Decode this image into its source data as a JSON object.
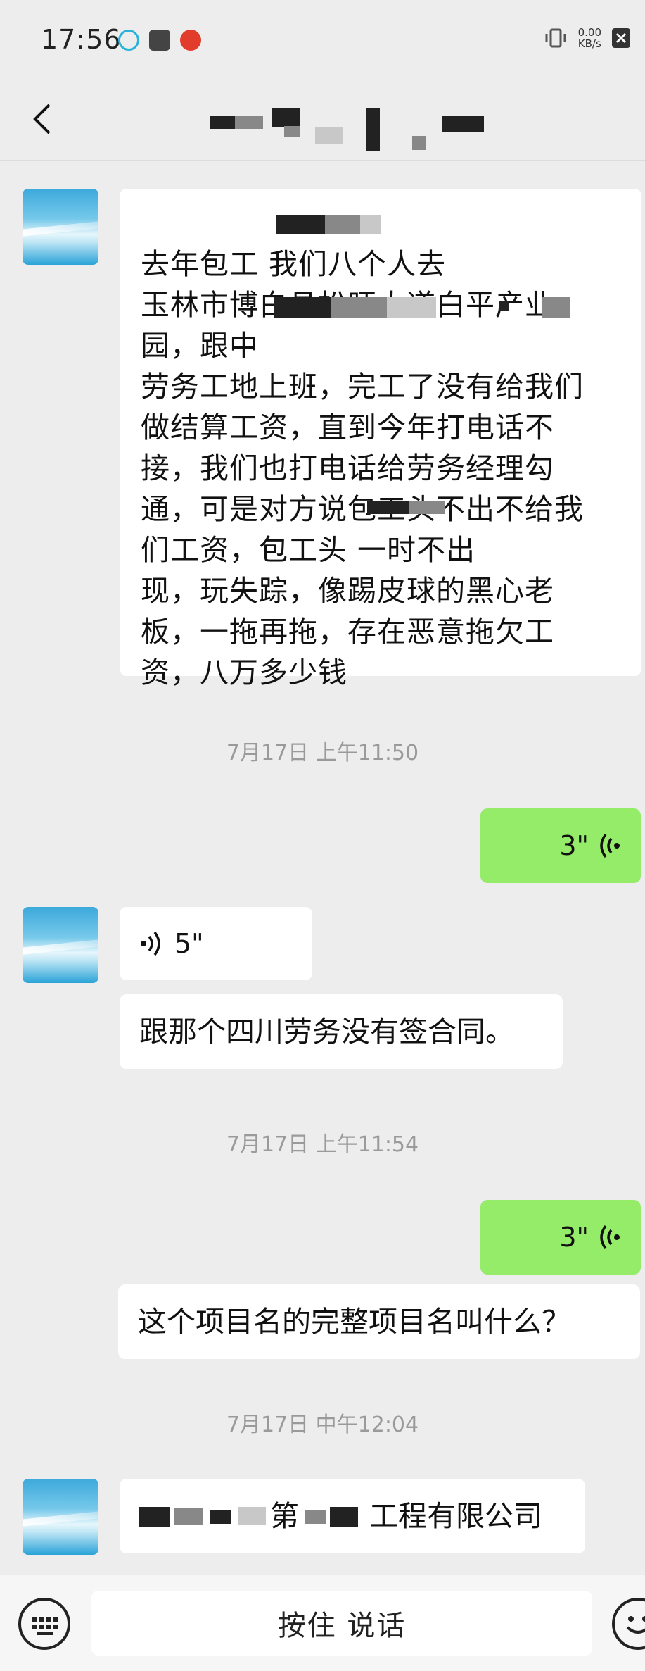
{
  "status_bar": {
    "time": "17:56",
    "net_speed_value": "0.00",
    "net_speed_unit": "KB/s"
  },
  "title_bar": {
    "title": ""
  },
  "messages": {
    "m1": "去年包工      我们八个人去\n玉林市博白县松旺大道白平产业\n园，跟中                  \n劳务工地上班，完工了没有给我们\n做结算工资，直到今年打电话不\n接，我们也打电话给劳务经理勾\n通，可是对方说包工头不出不给我\n们工资，包工头      一时不出\n现，玩失踪，像踢皮球的黑心老\n板，一拖再拖，存在恶意拖欠工\n资，八万多少钱",
    "ts1": "7月17日 上午11:50",
    "voice_out_1": "3\"",
    "voice_in_1": "5\"",
    "m2": "跟那个四川劳务没有签合同。",
    "ts2": "7月17日 上午11:54",
    "voice_out_2": "3\"",
    "m3": "这个项目名的完整项目名叫什么？",
    "ts3": "7月17日 中午12:04",
    "m4_part1": "第",
    "m4_part2": "工程有限公司"
  },
  "bottom_bar": {
    "hold_to_talk": "按住 说话"
  },
  "icons": [
    "back-icon",
    "keyboard-icon",
    "emoji-icon",
    "voice-wave-icon",
    "vibrate-icon",
    "close-box-icon"
  ]
}
